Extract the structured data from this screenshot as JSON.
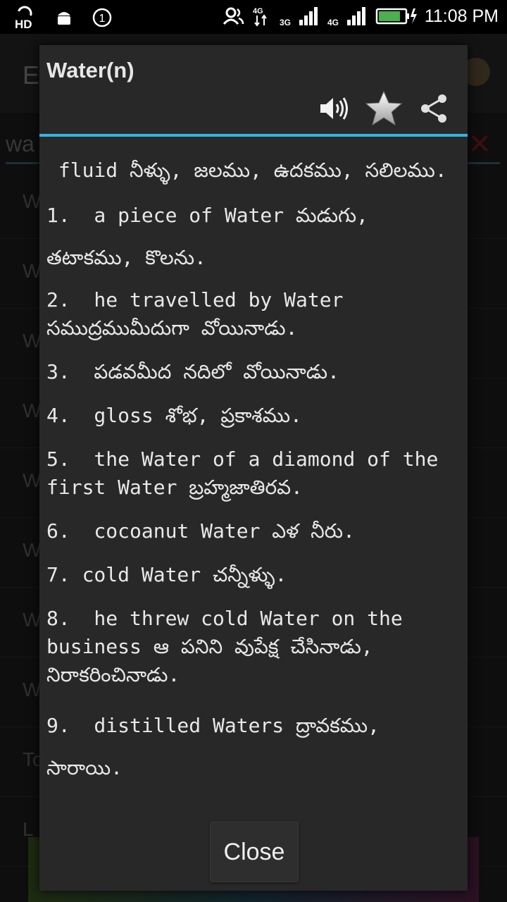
{
  "status_bar": {
    "hd_label": "HD",
    "notification_badge": "1",
    "network_4g": "4G",
    "network_3g": "3G",
    "network_4g_2": "4G",
    "time": "11:08 PM",
    "icons": [
      "hd-icon",
      "android-icon",
      "notification-count-icon",
      "person-icon",
      "signal-3g-icon",
      "signal-4g-icon",
      "battery-charging-icon"
    ]
  },
  "background_app": {
    "title_initial": "E",
    "search_text": "wa",
    "list_initials": [
      "W",
      "W",
      "W",
      "W",
      "W",
      "W",
      "W",
      "W",
      "To",
      "L"
    ]
  },
  "dialog": {
    "title": "Water(n)",
    "actions": {
      "speaker_icon": "speaker-icon",
      "favorite_icon": "star-icon",
      "share_icon": "share-icon"
    },
    "definition": " fluid నీళ్ళు, జలము, ఉదకము, సలిలము.",
    "items": [
      "1.  a piece of Water మడుగు, తటాకము, కొలను.",
      "2.  he travelled by Water సముద్రముమీదుగా వోయినాడు.",
      "3.  పడవమీద నదిలో వోయినాడు.",
      "4.  gloss శోభ, ప్రకాశము.",
      "5.  the Water of a diamond of the first Water బ్రహ్మజాతిరవ.",
      "6.  cocoanut Water ఎళ నీరు.",
      "7. cold Water చన్నీళ్ళు.",
      "8.  he threw cold Water on the business ఆ పనిని వుపేక్ష చేసినాడు, నిరాకరించినాడు.",
      "9.  distilled Waters ద్రావకము, సారాయి."
    ],
    "close_label": "Close"
  },
  "colors": {
    "accent": "#33b5e5",
    "dialog_bg": "#282828",
    "text": "#e8e8e8"
  }
}
